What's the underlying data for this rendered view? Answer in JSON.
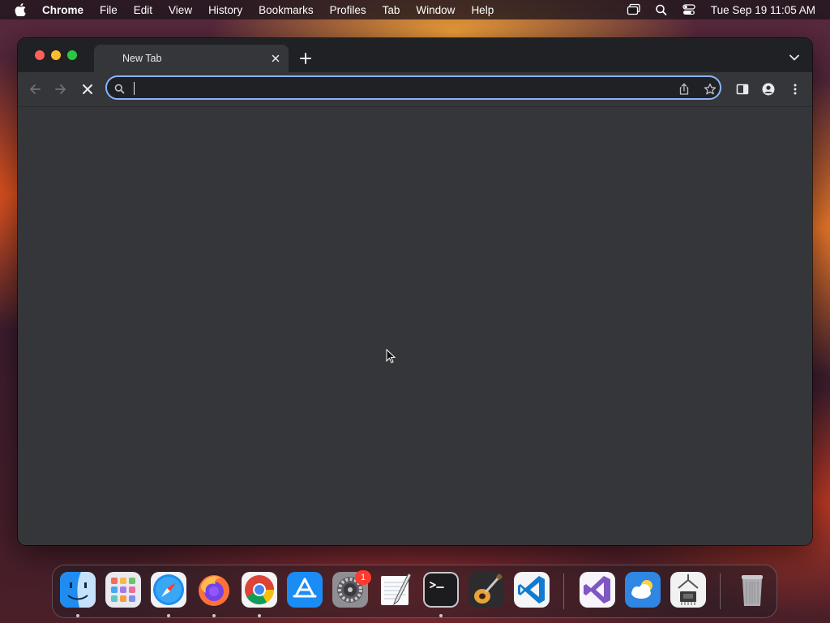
{
  "menubar": {
    "app_name": "Chrome",
    "items": [
      "File",
      "Edit",
      "View",
      "History",
      "Bookmarks",
      "Profiles",
      "Tab",
      "Window",
      "Help"
    ],
    "clock": "Tue Sep 19  11:05 AM",
    "status_icons": [
      "screen-mirroring-icon",
      "spotlight-search-icon",
      "control-center-icon"
    ]
  },
  "browser": {
    "tab": {
      "title": "New Tab"
    },
    "omnibox": {
      "value": "",
      "focused": true
    },
    "accent_color": "#8ab4f8"
  },
  "dock": {
    "apps": [
      {
        "name": "Finder",
        "running": true
      },
      {
        "name": "Launchpad",
        "running": false
      },
      {
        "name": "Safari",
        "running": true
      },
      {
        "name": "Firefox",
        "running": true
      },
      {
        "name": "Google Chrome",
        "running": true
      },
      {
        "name": "App Store",
        "running": false
      },
      {
        "name": "System Settings",
        "running": false,
        "badge": "1"
      },
      {
        "name": "TextEdit",
        "running": false
      },
      {
        "name": "Terminal",
        "running": true
      },
      {
        "name": "GarageBand",
        "running": false
      },
      {
        "name": "Visual Studio Code",
        "running": false
      },
      {
        "name": "Visual Studio",
        "running": false
      },
      {
        "name": "Weather",
        "running": false
      },
      {
        "name": "System Information",
        "running": false
      },
      {
        "name": "Trash",
        "running": false
      }
    ]
  }
}
